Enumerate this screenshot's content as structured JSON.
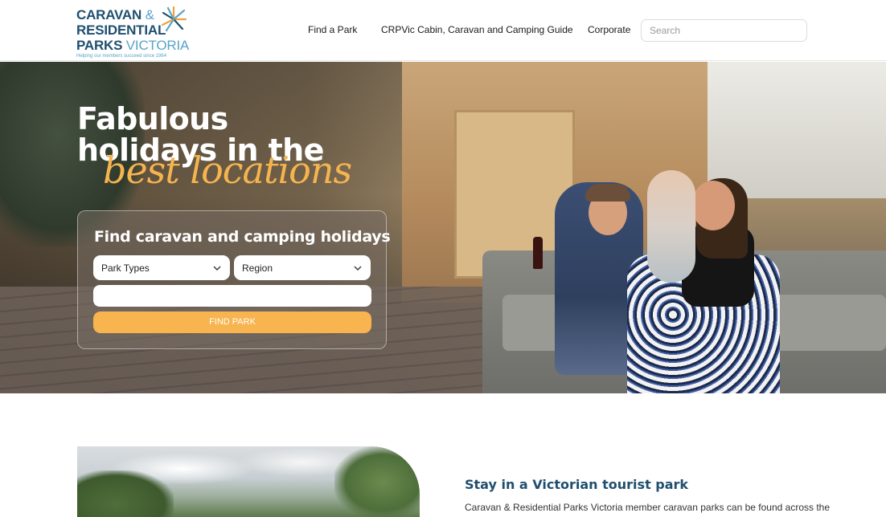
{
  "logo": {
    "line1": "CARAVAN",
    "amp": "&",
    "line2": "RESIDENTIAL",
    "line3a": "PARKS",
    "line3b": "VICTORIA",
    "tagline": "Helping our members succeed since 1964"
  },
  "nav": {
    "find_park": "Find a Park",
    "guide": "CRPVic Cabin, Caravan and Camping Guide",
    "corporate": "Corporate",
    "search_placeholder": "Search"
  },
  "hero": {
    "title_line1": "Fabulous",
    "title_line2": "holidays in the",
    "title_script": "best locations"
  },
  "search_card": {
    "title": "Find caravan and camping holidays",
    "park_types": "Park Types",
    "region": "Region",
    "keyword_value": "",
    "button": "FIND PARK"
  },
  "section": {
    "title": "Stay in a Victorian tourist park",
    "text": "Caravan & Residential Parks Victoria member caravan parks can be found across the"
  },
  "colors": {
    "brand_navy": "#1f4f6f",
    "brand_light_blue": "#5aa4c8",
    "accent_orange": "#f8b44e"
  },
  "icons": [
    "sun-logo-icon",
    "chevron-down-icon"
  ]
}
